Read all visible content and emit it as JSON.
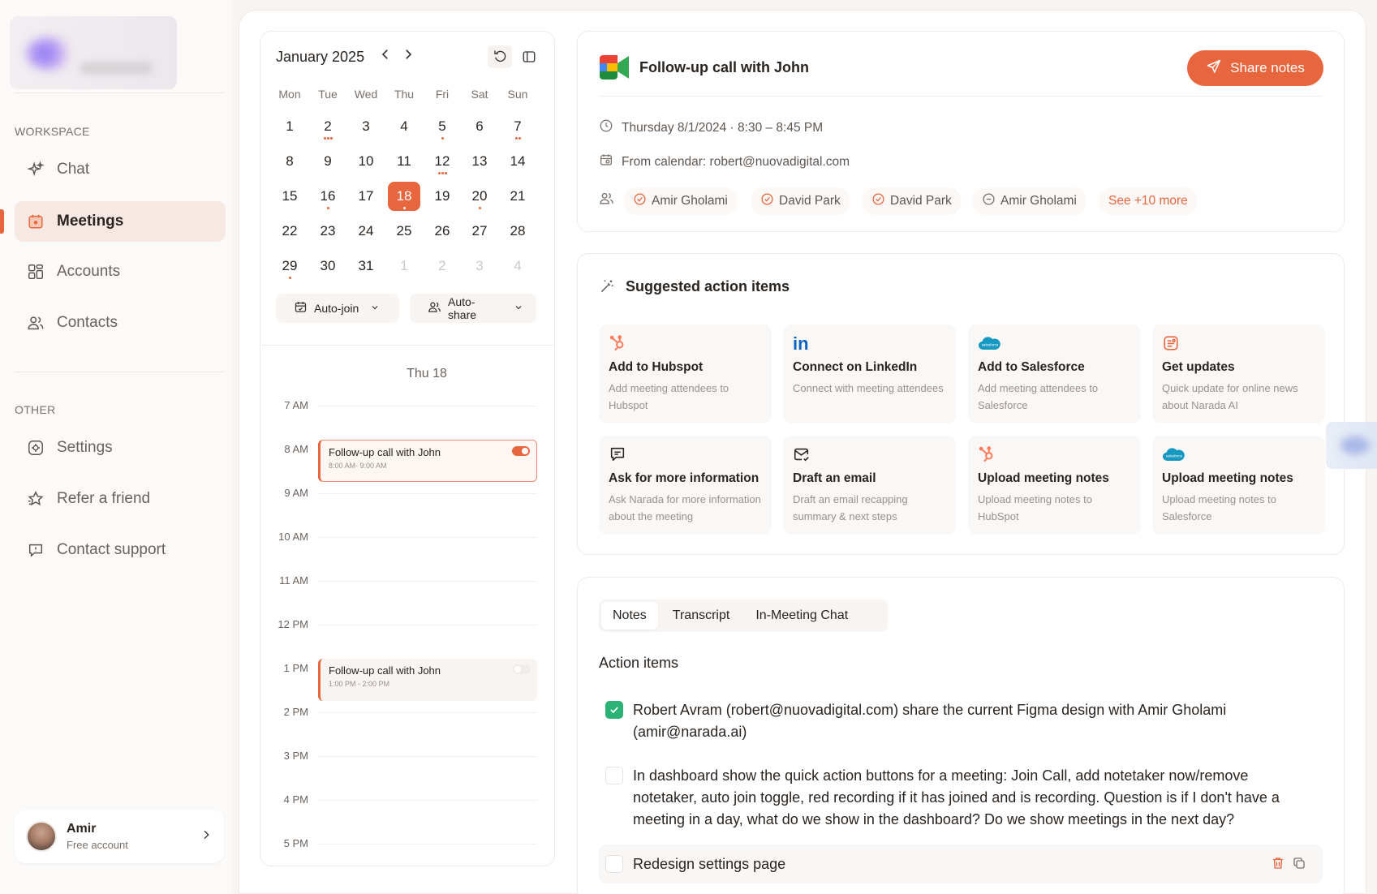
{
  "sidebar": {
    "workspace_label": "WORKSPACE",
    "other_label": "OTHER",
    "workspace_items": [
      {
        "label": "Chat",
        "icon": "sparkle-icon",
        "active": false
      },
      {
        "label": "Meetings",
        "icon": "calendar-icon",
        "active": true
      },
      {
        "label": "Accounts",
        "icon": "grid-icon",
        "active": false
      },
      {
        "label": "Contacts",
        "icon": "users-icon",
        "active": false
      }
    ],
    "other_items": [
      {
        "label": "Settings",
        "icon": "settings-icon"
      },
      {
        "label": "Refer a friend",
        "icon": "star-icon"
      },
      {
        "label": "Contact support",
        "icon": "support-icon"
      }
    ],
    "user": {
      "name": "Amir",
      "plan": "Free account"
    }
  },
  "calendar": {
    "month_label": "January 2025",
    "weekdays": [
      "Mon",
      "Tue",
      "Wed",
      "Thu",
      "Fri",
      "Sat",
      "Sun"
    ],
    "weeks": [
      [
        {
          "d": "1"
        },
        {
          "d": "2",
          "dots": 3
        },
        {
          "d": "3"
        },
        {
          "d": "4"
        },
        {
          "d": "5",
          "dots": 1
        },
        {
          "d": "6"
        },
        {
          "d": "7",
          "dots": 2
        }
      ],
      [
        {
          "d": "8"
        },
        {
          "d": "9"
        },
        {
          "d": "10"
        },
        {
          "d": "11"
        },
        {
          "d": "12",
          "dots": 3
        },
        {
          "d": "13"
        },
        {
          "d": "14"
        }
      ],
      [
        {
          "d": "15"
        },
        {
          "d": "16",
          "dots": 1
        },
        {
          "d": "17"
        },
        {
          "d": "18",
          "today": true,
          "dots": 1
        },
        {
          "d": "19"
        },
        {
          "d": "20",
          "dots": 1
        },
        {
          "d": "21"
        }
      ],
      [
        {
          "d": "22"
        },
        {
          "d": "23"
        },
        {
          "d": "24"
        },
        {
          "d": "25"
        },
        {
          "d": "26"
        },
        {
          "d": "27"
        },
        {
          "d": "28"
        }
      ],
      [
        {
          "d": "29",
          "dots": 1
        },
        {
          "d": "30"
        },
        {
          "d": "31"
        },
        {
          "d": "1",
          "muted": true
        },
        {
          "d": "2",
          "muted": true
        },
        {
          "d": "3",
          "muted": true
        },
        {
          "d": "4",
          "muted": true
        }
      ]
    ],
    "auto_join_label": "Auto-join",
    "auto_share_label": "Auto-share",
    "day_view": {
      "header": "Thu 18",
      "hours": [
        "7 AM",
        "8 AM",
        "9 AM",
        "10 AM",
        "11 AM",
        "12 PM",
        "1 PM",
        "2 PM",
        "3 PM",
        "4 PM",
        "5 PM"
      ],
      "events": [
        {
          "title": "Follow-up call with John",
          "time": "8:00 AM- 9:00 AM",
          "toggle_on": true
        },
        {
          "title": "Follow-up call with John",
          "time": "1:00 PM - 2:00 PM",
          "toggle_on": false
        }
      ]
    }
  },
  "meeting": {
    "title": "Follow-up call with John",
    "share_label": "Share notes",
    "datetime": "Thursday 8/1/2024 · 8:30 – 8:45 PM",
    "calendar_source": "From calendar: robert@nuovadigital.com",
    "attendees": [
      {
        "name": "Amir Gholami",
        "status": "accepted"
      },
      {
        "name": "David Park",
        "status": "accepted"
      },
      {
        "name": "David Park",
        "status": "accepted"
      },
      {
        "name": "Amir Gholami",
        "status": "pending"
      }
    ],
    "more_label": "See +10 more"
  },
  "suggested": {
    "title": "Suggested action items",
    "items": [
      {
        "title": "Add to Hubspot",
        "desc": "Add meeting attendees to Hubspot",
        "icon": "hubspot-icon"
      },
      {
        "title": "Connect on LinkedIn",
        "desc": "Connect with meeting attendees",
        "icon": "linkedin-icon"
      },
      {
        "title": "Add to Salesforce",
        "desc": "Add meeting attendees to Salesforce",
        "icon": "salesforce-icon"
      },
      {
        "title": "Get updates",
        "desc": "Quick update for online news about Narada AI",
        "icon": "news-icon"
      },
      {
        "title": "Ask for more information",
        "desc": "Ask Narada for more information about the meeting",
        "icon": "chat-bubble-icon"
      },
      {
        "title": "Draft an email",
        "desc": "Draft an email recapping summary & next steps",
        "icon": "mail-icon"
      },
      {
        "title": "Upload meeting notes",
        "desc": "Upload meeting notes to HubSpot",
        "icon": "hubspot-icon"
      },
      {
        "title": "Upload meeting notes",
        "desc": "Upload meeting notes to Salesforce",
        "icon": "salesforce-icon"
      }
    ]
  },
  "notes": {
    "tabs": [
      "Notes",
      "Transcript",
      "In-Meeting Chat"
    ],
    "active_tab": "Notes",
    "section_title": "Action items",
    "items": [
      {
        "text": "Robert Avram (robert@nuovadigital.com) share the current Figma design with Amir Gholami (amir@narada.ai)",
        "checked": true
      },
      {
        "text": "In dashboard show the quick action buttons for a meeting: Join Call, add notetaker now/remove notetaker, auto join toggle, red recording if it has joined and is recording. Question is if I don't have a meeting in a day, what do we show in the dashboard? Do we show meetings in the next day?",
        "checked": false
      },
      {
        "text": "Redesign settings page",
        "checked": false
      }
    ]
  },
  "colors": {
    "accent": "#e8663d",
    "check": "#2bb274",
    "linkedin": "#0a66c2",
    "salesforce": "#1798c1"
  }
}
